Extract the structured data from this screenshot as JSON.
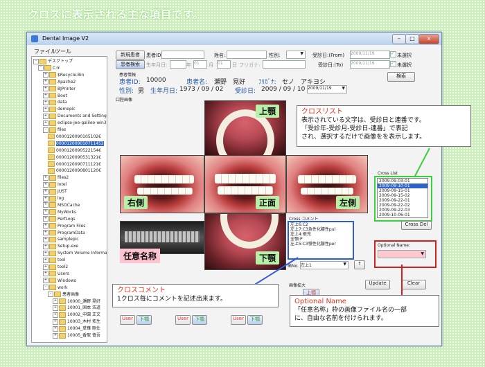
{
  "banner": "クロスに表示される主な項目です。",
  "window": {
    "title": "Dental Image V2",
    "min": "–",
    "max": "□",
    "close": "x"
  },
  "menu": [
    "ファイル",
    "ツール"
  ],
  "tree": [
    {
      "label": "デスクトップ",
      "lvl": 0,
      "exp": "-"
    },
    {
      "label": "C:¥",
      "lvl": 1,
      "exp": "-"
    },
    {
      "label": "$Recycle.Bin",
      "lvl": 2,
      "exp": "+"
    },
    {
      "label": "Apache2",
      "lvl": 2,
      "exp": "+"
    },
    {
      "label": "BJPrinter",
      "lvl": 2,
      "exp": "+"
    },
    {
      "label": "Boot",
      "lvl": 2,
      "exp": "+"
    },
    {
      "label": "data",
      "lvl": 2,
      "exp": "+"
    },
    {
      "label": "demopic",
      "lvl": 2,
      "exp": "+"
    },
    {
      "label": "Documents and Settings",
      "lvl": 2,
      "exp": "+"
    },
    {
      "label": "eclipse-jee-galileo-win3",
      "lvl": 2,
      "exp": "+"
    },
    {
      "label": "files",
      "lvl": 2,
      "exp": "-"
    },
    {
      "label": "0000120090105102€",
      "lvl": 3,
      "exp": ""
    },
    {
      "label": "000012009010711452",
      "lvl": 3,
      "exp": "",
      "sel": true
    },
    {
      "label": "0000120090522154€",
      "lvl": 3,
      "exp": ""
    },
    {
      "label": "0000120090531321€",
      "lvl": 3,
      "exp": ""
    },
    {
      "label": "0000120090711121€",
      "lvl": 3,
      "exp": ""
    },
    {
      "label": "0000120090801120€",
      "lvl": 3,
      "exp": ""
    },
    {
      "label": "files2",
      "lvl": 2,
      "exp": "+"
    },
    {
      "label": "Intel",
      "lvl": 2,
      "exp": "+"
    },
    {
      "label": "JUST",
      "lvl": 2,
      "exp": "+"
    },
    {
      "label": "log",
      "lvl": 2,
      "exp": "+"
    },
    {
      "label": "MSOCache",
      "lvl": 2,
      "exp": "+"
    },
    {
      "label": "MyWorks",
      "lvl": 2,
      "exp": "+"
    },
    {
      "label": "PerfLogs",
      "lvl": 2,
      "exp": "+"
    },
    {
      "label": "Program Files",
      "lvl": 2,
      "exp": "+"
    },
    {
      "label": "ProgramData",
      "lvl": 2,
      "exp": "+"
    },
    {
      "label": "samplepic",
      "lvl": 2,
      "exp": "+"
    },
    {
      "label": "Setup.exe",
      "lvl": 2,
      "exp": "+"
    },
    {
      "label": "System Volume Informat",
      "lvl": 2,
      "exp": "+"
    },
    {
      "label": "tool",
      "lvl": 2,
      "exp": "+"
    },
    {
      "label": "tool2",
      "lvl": 2,
      "exp": "+"
    },
    {
      "label": "Users",
      "lvl": 2,
      "exp": "+"
    },
    {
      "label": "Windows",
      "lvl": 2,
      "exp": "+"
    },
    {
      "label": "work",
      "lvl": 2,
      "exp": "-"
    },
    {
      "label": "患者画像",
      "lvl": 3,
      "exp": "-"
    },
    {
      "label": "10000_瀬野 晃好",
      "lvl": 4,
      "exp": "+"
    },
    {
      "label": "10001_国本 浩道",
      "lvl": 4,
      "exp": "+"
    },
    {
      "label": "10002_中園 正文",
      "lvl": 4,
      "exp": "+"
    },
    {
      "label": "10003_木村 拓生",
      "lvl": 4,
      "exp": "+"
    },
    {
      "label": "10004_草薙 剛仕",
      "lvl": 4,
      "exp": "+"
    },
    {
      "label": "10005_香取 慎吾",
      "lvl": 4,
      "exp": "+"
    }
  ],
  "search": {
    "new_patient": "新規患者",
    "patient_id_label": "患者ID:",
    "name_label": "姓名:",
    "gender_label": "性別:",
    "visit_from_label": "受診日:(From)",
    "visit_from_value": "2009/11/19",
    "unselected1": "未選択",
    "patient_search": "患者検索",
    "birth_label": "生年月日:",
    "year_unit": "年",
    "birth_month": "01",
    "month_unit": "月",
    "birth_day": "01",
    "day_unit": "日",
    "kana_label": "フリガナ:",
    "visit_to_label": "受診日:(To)",
    "visit_to_value": "2009/11/19",
    "unselected2": "未選択",
    "search_button": "検索"
  },
  "patient": {
    "section": "患者情報",
    "id_label": "患者ID:",
    "id": "10000",
    "name_label": "患者名:",
    "name": "瀬野　晃好",
    "kana_label": "ﾌﾘｶﾞﾅ:",
    "kana": "セノ　アキヨシ",
    "gender_label": "性別:",
    "gender": "男",
    "birth_label": "生年月日:",
    "birth": "1973 / 09 / 02",
    "visit_label": "受診日:",
    "visit": "2009 / 09 / 10",
    "visit_select": "2009/11/19"
  },
  "oral": {
    "section": "口腔画像",
    "upper": "上顎",
    "right": "右側",
    "front": "正面",
    "left": "左側",
    "lower": "下顎",
    "optional": "任意名称"
  },
  "cross_list": {
    "title": "クロスリスト",
    "text": [
      "表示されている文字は、受診日と連番です。",
      "「受診年-受診月-受診日-連番」で表記",
      "され、選択するだけで画像をを表示します。"
    ],
    "label": "Cross List",
    "items": [
      "2009-09-03-01",
      "2009-09-10-01",
      "2009-09-15-01",
      "2009-09-15-02",
      "2009-09-22-01",
      "2009-09-22-02",
      "2009-09-22-03",
      "2009-10-06-01"
    ],
    "selected_index": 1,
    "del_button": "Cross Del"
  },
  "cross_comment": {
    "label": "Cross コメント",
    "lines": [
      "左上6:C2",
      "左上7:C3急性化膿性pul",
      "左上4:根充",
      "全顎:P",
      "左上5:C3慢性化膿性per"
    ],
    "tooth_label": "歯No.",
    "tooth_value": "左上1",
    "up_button": "↑"
  },
  "cross_comment_callout": {
    "title": "クロスコメント",
    "text": "1クロス毎にコメントを記述出来ます。"
  },
  "optional_name": {
    "label": "Optional Name:"
  },
  "optional_callout": {
    "title": "Optional Name",
    "text": [
      "「任意名称」枠の画像ファイル名の一部",
      "に、自由な名前を付けられます。"
    ]
  },
  "bottom": {
    "zoom_label": "画像拡大",
    "zoom_btn": "上顎",
    "update": "Update",
    "clear": "Clear",
    "user": "User",
    "lower": "下顎"
  }
}
